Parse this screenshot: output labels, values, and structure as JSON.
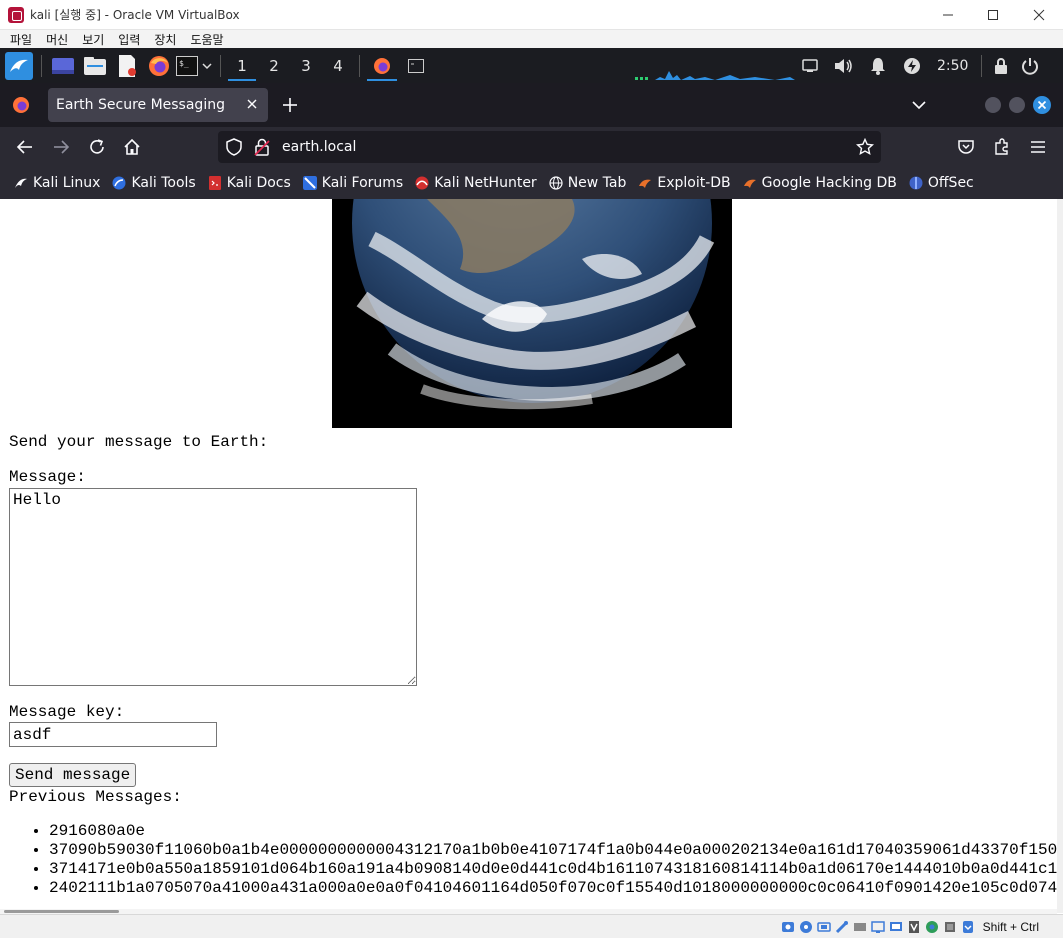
{
  "window": {
    "title": "kali [실행 중] - Oracle VM VirtualBox",
    "vbox_menu": [
      "파일",
      "머신",
      "보기",
      "입력",
      "장치",
      "도움말"
    ]
  },
  "panel": {
    "workspaces": [
      "1",
      "2",
      "3",
      "4"
    ],
    "active_workspace": "1",
    "clock": "2:50"
  },
  "browser": {
    "tab_title": "Earth Secure Messaging",
    "url": "earth.local",
    "bookmarks": [
      "Kali Linux",
      "Kali Tools",
      "Kali Docs",
      "Kali Forums",
      "Kali NetHunter",
      "New Tab",
      "Exploit-DB",
      "Google Hacking DB",
      "OffSec"
    ]
  },
  "page": {
    "form_heading": "Send your message to Earth:",
    "message_label": "Message:",
    "message_value": "Hello",
    "key_label": "Message key:",
    "key_value": "asdf",
    "send_button": "Send message",
    "previous_heading": "Previous Messages:",
    "previous_messages": [
      "2916080a0e",
      "37090b59030f11060b0a1b4e0000000000004312170a1b0b0e4107174f1a0b044e0a000202134e0a161d17040359061d43370f150",
      "3714171e0b0a550a1859101d064b160a191a4b0908140d0e0d441c0d4b1611074318160814114b0a1d06170e1444010b0a0d441c1",
      "2402111b1a0705070a41000a431a000a0e0a0f04104601164d050f070c0f15540d1018000000000c0c06410f0901420e105c0d074"
    ]
  },
  "statusbar": {
    "host_key": "Shift + Ctrl"
  },
  "colors": {
    "firefox_dark": "#1c1b22",
    "firefox_toolbar": "#2b2a33",
    "tab_active": "#42414d",
    "kali_panel": "#1b1c21",
    "kali_accent": "#2f8fe0"
  }
}
